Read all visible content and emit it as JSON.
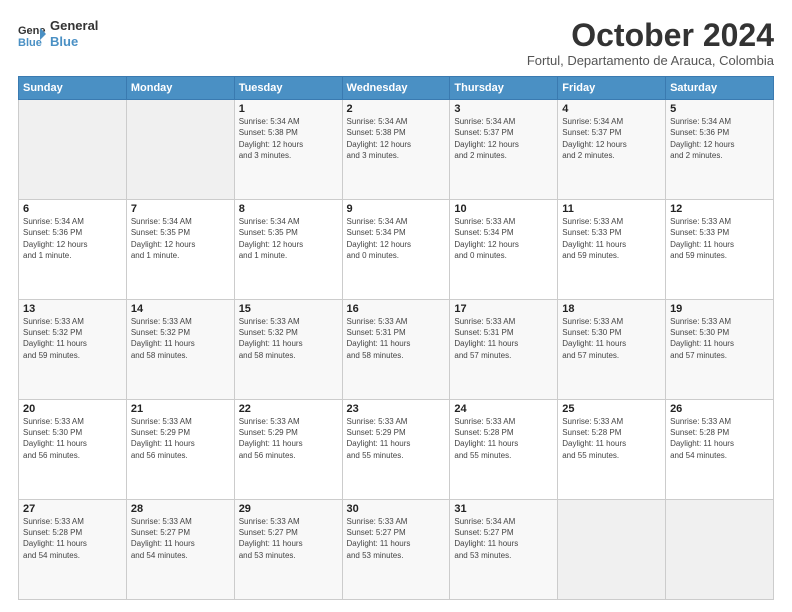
{
  "logo": {
    "line1": "General",
    "line2": "Blue"
  },
  "title": "October 2024",
  "location": "Fortul, Departamento de Arauca, Colombia",
  "weekdays": [
    "Sunday",
    "Monday",
    "Tuesday",
    "Wednesday",
    "Thursday",
    "Friday",
    "Saturday"
  ],
  "weeks": [
    [
      {
        "day": "",
        "info": ""
      },
      {
        "day": "",
        "info": ""
      },
      {
        "day": "1",
        "info": "Sunrise: 5:34 AM\nSunset: 5:38 PM\nDaylight: 12 hours\nand 3 minutes."
      },
      {
        "day": "2",
        "info": "Sunrise: 5:34 AM\nSunset: 5:38 PM\nDaylight: 12 hours\nand 3 minutes."
      },
      {
        "day": "3",
        "info": "Sunrise: 5:34 AM\nSunset: 5:37 PM\nDaylight: 12 hours\nand 2 minutes."
      },
      {
        "day": "4",
        "info": "Sunrise: 5:34 AM\nSunset: 5:37 PM\nDaylight: 12 hours\nand 2 minutes."
      },
      {
        "day": "5",
        "info": "Sunrise: 5:34 AM\nSunset: 5:36 PM\nDaylight: 12 hours\nand 2 minutes."
      }
    ],
    [
      {
        "day": "6",
        "info": "Sunrise: 5:34 AM\nSunset: 5:36 PM\nDaylight: 12 hours\nand 1 minute."
      },
      {
        "day": "7",
        "info": "Sunrise: 5:34 AM\nSunset: 5:35 PM\nDaylight: 12 hours\nand 1 minute."
      },
      {
        "day": "8",
        "info": "Sunrise: 5:34 AM\nSunset: 5:35 PM\nDaylight: 12 hours\nand 1 minute."
      },
      {
        "day": "9",
        "info": "Sunrise: 5:34 AM\nSunset: 5:34 PM\nDaylight: 12 hours\nand 0 minutes."
      },
      {
        "day": "10",
        "info": "Sunrise: 5:33 AM\nSunset: 5:34 PM\nDaylight: 12 hours\nand 0 minutes."
      },
      {
        "day": "11",
        "info": "Sunrise: 5:33 AM\nSunset: 5:33 PM\nDaylight: 11 hours\nand 59 minutes."
      },
      {
        "day": "12",
        "info": "Sunrise: 5:33 AM\nSunset: 5:33 PM\nDaylight: 11 hours\nand 59 minutes."
      }
    ],
    [
      {
        "day": "13",
        "info": "Sunrise: 5:33 AM\nSunset: 5:32 PM\nDaylight: 11 hours\nand 59 minutes."
      },
      {
        "day": "14",
        "info": "Sunrise: 5:33 AM\nSunset: 5:32 PM\nDaylight: 11 hours\nand 58 minutes."
      },
      {
        "day": "15",
        "info": "Sunrise: 5:33 AM\nSunset: 5:32 PM\nDaylight: 11 hours\nand 58 minutes."
      },
      {
        "day": "16",
        "info": "Sunrise: 5:33 AM\nSunset: 5:31 PM\nDaylight: 11 hours\nand 58 minutes."
      },
      {
        "day": "17",
        "info": "Sunrise: 5:33 AM\nSunset: 5:31 PM\nDaylight: 11 hours\nand 57 minutes."
      },
      {
        "day": "18",
        "info": "Sunrise: 5:33 AM\nSunset: 5:30 PM\nDaylight: 11 hours\nand 57 minutes."
      },
      {
        "day": "19",
        "info": "Sunrise: 5:33 AM\nSunset: 5:30 PM\nDaylight: 11 hours\nand 57 minutes."
      }
    ],
    [
      {
        "day": "20",
        "info": "Sunrise: 5:33 AM\nSunset: 5:30 PM\nDaylight: 11 hours\nand 56 minutes."
      },
      {
        "day": "21",
        "info": "Sunrise: 5:33 AM\nSunset: 5:29 PM\nDaylight: 11 hours\nand 56 minutes."
      },
      {
        "day": "22",
        "info": "Sunrise: 5:33 AM\nSunset: 5:29 PM\nDaylight: 11 hours\nand 56 minutes."
      },
      {
        "day": "23",
        "info": "Sunrise: 5:33 AM\nSunset: 5:29 PM\nDaylight: 11 hours\nand 55 minutes."
      },
      {
        "day": "24",
        "info": "Sunrise: 5:33 AM\nSunset: 5:28 PM\nDaylight: 11 hours\nand 55 minutes."
      },
      {
        "day": "25",
        "info": "Sunrise: 5:33 AM\nSunset: 5:28 PM\nDaylight: 11 hours\nand 55 minutes."
      },
      {
        "day": "26",
        "info": "Sunrise: 5:33 AM\nSunset: 5:28 PM\nDaylight: 11 hours\nand 54 minutes."
      }
    ],
    [
      {
        "day": "27",
        "info": "Sunrise: 5:33 AM\nSunset: 5:28 PM\nDaylight: 11 hours\nand 54 minutes."
      },
      {
        "day": "28",
        "info": "Sunrise: 5:33 AM\nSunset: 5:27 PM\nDaylight: 11 hours\nand 54 minutes."
      },
      {
        "day": "29",
        "info": "Sunrise: 5:33 AM\nSunset: 5:27 PM\nDaylight: 11 hours\nand 53 minutes."
      },
      {
        "day": "30",
        "info": "Sunrise: 5:33 AM\nSunset: 5:27 PM\nDaylight: 11 hours\nand 53 minutes."
      },
      {
        "day": "31",
        "info": "Sunrise: 5:34 AM\nSunset: 5:27 PM\nDaylight: 11 hours\nand 53 minutes."
      },
      {
        "day": "",
        "info": ""
      },
      {
        "day": "",
        "info": ""
      }
    ]
  ]
}
